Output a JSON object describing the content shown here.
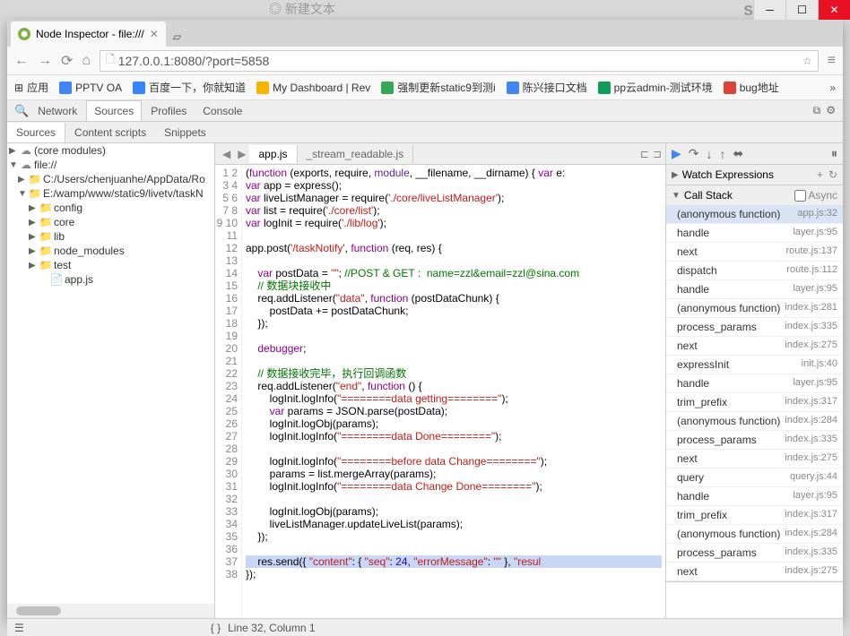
{
  "window": {
    "title": "Node Inspector - file:///"
  },
  "url": "127.0.0.1:8080/?port=5858",
  "bookmarks": {
    "apps": "应用",
    "items": [
      {
        "label": "PPTV OA"
      },
      {
        "label": "百度一下，你就知道"
      },
      {
        "label": "My Dashboard | Rev"
      },
      {
        "label": "强制更新static9到测i"
      },
      {
        "label": "陈兴接口文档"
      },
      {
        "label": "pp云admin-测试环境"
      },
      {
        "label": "bug地址"
      }
    ]
  },
  "devtabs": {
    "network": "Network",
    "sources": "Sources",
    "profiles": "Profiles",
    "console": "Console"
  },
  "subtabs": {
    "sources": "Sources",
    "content": "Content scripts",
    "snippets": "Snippets"
  },
  "tree": {
    "core": "(core modules)",
    "file": "file://",
    "path1": "C:/Users/chenjuanhe/AppData/Ro",
    "path2": "E:/wamp/www/static9/livetv/taskN",
    "config": "config",
    "core2": "core",
    "lib": "lib",
    "node_modules": "node_modules",
    "test": "test",
    "appjs": "app.js"
  },
  "editor_tabs": {
    "app": "app.js",
    "stream": "_stream_readable.js"
  },
  "watch": {
    "title": "Watch Expressions"
  },
  "callstack": {
    "title": "Call Stack",
    "async": "Async"
  },
  "stack": [
    {
      "fn": "(anonymous function)",
      "loc": "app.js:32",
      "active": true
    },
    {
      "fn": "handle",
      "loc": "layer.js:95"
    },
    {
      "fn": "next",
      "loc": "route.js:137"
    },
    {
      "fn": "dispatch",
      "loc": "route.js:112"
    },
    {
      "fn": "handle",
      "loc": "layer.js:95"
    },
    {
      "fn": "(anonymous function)",
      "loc": "index.js:281"
    },
    {
      "fn": "process_params",
      "loc": "index.js:335"
    },
    {
      "fn": "next",
      "loc": "index.js:275"
    },
    {
      "fn": "expressInit",
      "loc": "init.js:40"
    },
    {
      "fn": "handle",
      "loc": "layer.js:95"
    },
    {
      "fn": "trim_prefix",
      "loc": "index.js:317"
    },
    {
      "fn": "(anonymous function)",
      "loc": "index.js:284"
    },
    {
      "fn": "process_params",
      "loc": "index.js:335"
    },
    {
      "fn": "next",
      "loc": "index.js:275"
    },
    {
      "fn": "query",
      "loc": "query.js:44"
    },
    {
      "fn": "handle",
      "loc": "layer.js:95"
    },
    {
      "fn": "trim_prefix",
      "loc": "index.js:317"
    },
    {
      "fn": "(anonymous function)",
      "loc": "index.js:284"
    },
    {
      "fn": "process_params",
      "loc": "index.js:335"
    },
    {
      "fn": "next",
      "loc": "index.js:275"
    }
  ],
  "status": {
    "cursor": "Line 32, Column 1"
  },
  "code_lines": 38
}
